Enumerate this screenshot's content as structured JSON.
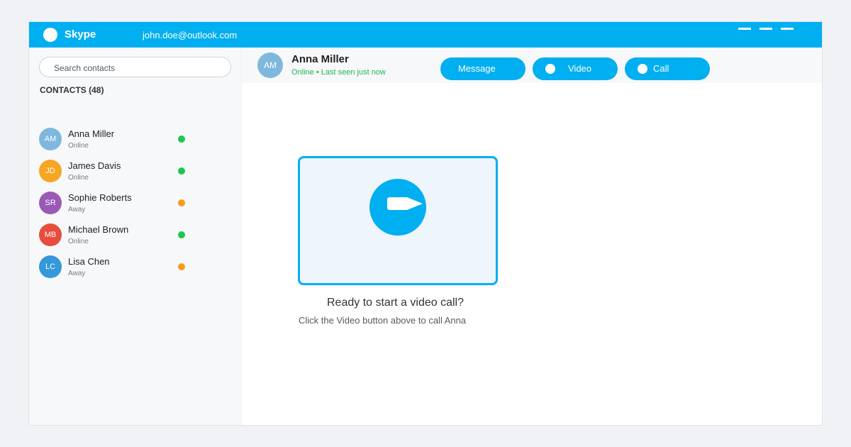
{
  "titlebar": {
    "app_name": "Skype",
    "account_email": "john.doe@outlook.com",
    "brand_color": "#00aff0"
  },
  "sidebar": {
    "search_placeholder": "Search contacts",
    "contacts_header": "CONTACTS (48)",
    "contacts": [
      {
        "initials": "AM",
        "name": "Anna Miller",
        "status": "Online",
        "avatar_color": "#7fb8dd",
        "dot_color": "#1ec84a"
      },
      {
        "initials": "JD",
        "name": "James Davis",
        "status": "Online",
        "avatar_color": "#f5a623",
        "dot_color": "#1ec84a"
      },
      {
        "initials": "SR",
        "name": "Sophie Roberts",
        "status": "Away",
        "avatar_color": "#9b59b6",
        "dot_color": "#f59c1a"
      },
      {
        "initials": "MB",
        "name": "Michael Brown",
        "status": "Online",
        "avatar_color": "#e74c3c",
        "dot_color": "#1ec84a"
      },
      {
        "initials": "LC",
        "name": "Lisa Chen",
        "status": "Away",
        "avatar_color": "#3498db",
        "dot_color": "#f59c1a"
      }
    ]
  },
  "chat_header": {
    "initials": "AM",
    "avatar_color": "#7fb8dd",
    "name": "Anna Miller",
    "status": "Online • Last seen just now",
    "buttons": {
      "message": "Message",
      "video": "Video",
      "call": "Call"
    }
  },
  "main": {
    "icon": "video-camera-icon",
    "prompt": "Ready to start a video call?",
    "hint": "Click the Video button above to call Anna"
  }
}
